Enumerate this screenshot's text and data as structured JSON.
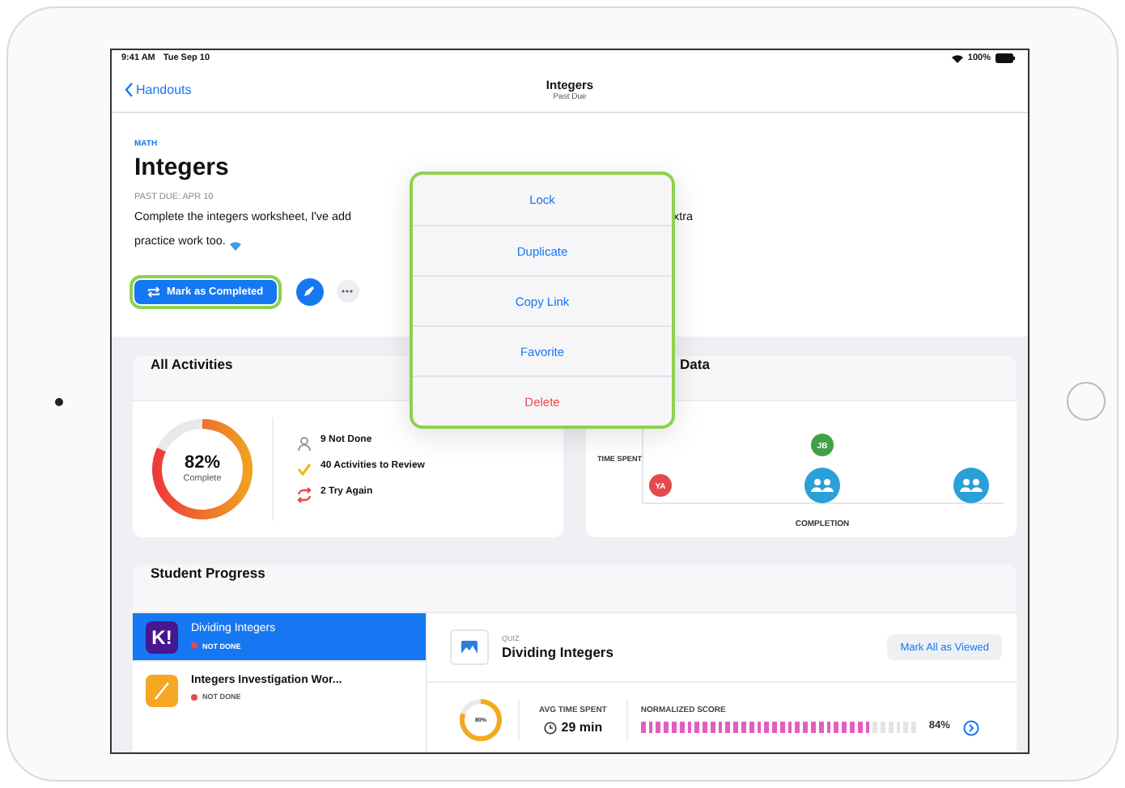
{
  "status_bar": {
    "time": "9:41 AM",
    "date": "Tue Sep 10",
    "battery": "100%"
  },
  "nav": {
    "back": "Handouts",
    "title": "Integers",
    "subtitle": "Past Due"
  },
  "header": {
    "subject": "MATH",
    "title": "Integers",
    "due": "PAST DUE: APR 10",
    "description": [
      "Complete the integers worksheet, I've add",
      "xtra",
      "practice work too."
    ],
    "actions": [
      {
        "kind": "primary",
        "label": "Mark as Completed",
        "highlighted": true
      },
      {
        "kind": "edit"
      },
      {
        "kind": "more"
      }
    ]
  },
  "popover": {
    "highlighted": true,
    "items": [
      {
        "label": "Lock",
        "kind": "normal"
      },
      {
        "label": "Duplicate",
        "kind": "normal"
      },
      {
        "label": "Copy Link",
        "kind": "normal"
      },
      {
        "label": "Favorite",
        "kind": "normal"
      },
      {
        "label": "Delete",
        "kind": "destructive"
      }
    ]
  },
  "all_activities": {
    "title": "All Activities",
    "ring": {
      "level": 0.82,
      "value": "82%",
      "caption": "Complete"
    },
    "legend": [
      {
        "kind": "not_done",
        "label": "9 Not Done"
      },
      {
        "kind": "review",
        "label": "40 Activities to Review"
      },
      {
        "kind": "retry",
        "label": "2 Try Again"
      }
    ]
  },
  "data_card": {
    "title": "Data",
    "ylabel": "TIME SPENT",
    "xlabel": "COMPLETION",
    "points": [
      {
        "kind": "initials",
        "label": "YA",
        "color": "#e5484d"
      },
      {
        "kind": "initials",
        "label": "JB",
        "color": "#43a047"
      },
      {
        "kind": "group",
        "color": "#2a9fd8"
      },
      {
        "kind": "group",
        "color": "#2a9fd8"
      }
    ]
  },
  "student_progress": {
    "title": "Student Progress",
    "activities": [
      {
        "kind": "kahoot",
        "logo": "K!",
        "title": "Dividing Integers",
        "status": "NOT DONE",
        "selected": true
      },
      {
        "kind": "pages",
        "title": "Integers Investigation Wor...",
        "status": "NOT DONE",
        "selected": false
      }
    ],
    "detail": {
      "type": "QUIZ",
      "title": "Dividing Integers",
      "button": "Mark All as Viewed",
      "completion": {
        "level": 0.8,
        "value": "80%"
      },
      "avg_time": {
        "label": "AVG TIME SPENT",
        "value": "29 min"
      },
      "score": {
        "label": "NORMALIZED SCORE",
        "level": 0.84,
        "value": "84%"
      }
    }
  }
}
